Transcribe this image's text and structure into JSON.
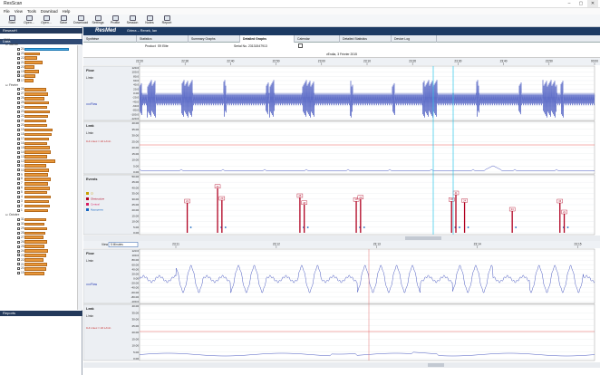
{
  "window": {
    "title": "ResScan",
    "min": "–",
    "max": "▢",
    "close": "✕"
  },
  "menu": [
    "File",
    "View",
    "Tools",
    "Download",
    "Help"
  ],
  "toolbar": [
    {
      "label": "Start",
      "icon": "start-icon"
    },
    {
      "label": "Open...",
      "icon": "folder-open-icon"
    },
    {
      "label": "Open...",
      "icon": "folder-open-icon"
    },
    {
      "label": "Save",
      "icon": "save-icon"
    },
    {
      "label": "Download",
      "icon": "download-icon"
    },
    {
      "label": "Settings",
      "icon": "gear-icon"
    },
    {
      "label": "Profile",
      "icon": "profile-icon"
    },
    {
      "label": "Session",
      "icon": "session-icon"
    },
    {
      "label": "Notes",
      "icon": "notes-icon"
    },
    {
      "label": "Report",
      "icon": "report-icon"
    }
  ],
  "left": {
    "header": "ResearH",
    "subheader": "Data",
    "reports_header": "Reports",
    "tree": [
      {
        "label": "2015",
        "level": 0
      },
      {
        "label": "Janvier",
        "level": 1
      },
      {
        "label": "24",
        "bar": 0.88,
        "selected": true
      },
      {
        "label": "23",
        "bar": 0.3
      },
      {
        "label": "22",
        "bar": 0.25
      },
      {
        "label": "21",
        "bar": 0.35
      },
      {
        "label": "20",
        "bar": 0.2
      },
      {
        "label": "19",
        "bar": 0.28
      },
      {
        "label": "18",
        "bar": 0.22
      },
      {
        "label": "17",
        "bar": 0.18
      },
      {
        "label": "Février",
        "level": 1
      },
      {
        "label": "28",
        "bar": 0.42
      },
      {
        "label": "27",
        "bar": 0.46
      },
      {
        "label": "26",
        "bar": 0.4
      },
      {
        "label": "25",
        "bar": 0.48
      },
      {
        "label": "24",
        "bar": 0.44
      },
      {
        "label": "23",
        "bar": 0.5
      },
      {
        "label": "22",
        "bar": 0.47
      },
      {
        "label": "21",
        "bar": 0.42
      },
      {
        "label": "20",
        "bar": 0.45
      },
      {
        "label": "19",
        "bar": 0.55
      },
      {
        "label": "18",
        "bar": 0.53
      },
      {
        "label": "17",
        "bar": 0.48
      },
      {
        "label": "16",
        "bar": 0.44
      },
      {
        "label": "15",
        "bar": 0.5
      },
      {
        "label": "14",
        "bar": 0.52
      },
      {
        "label": "13",
        "bar": 0.45
      },
      {
        "label": "12",
        "bar": 0.6
      },
      {
        "label": "11",
        "bar": 0.43
      },
      {
        "label": "10",
        "bar": 0.49
      },
      {
        "label": "9",
        "bar": 0.47
      },
      {
        "label": "8",
        "bar": 0.51
      },
      {
        "label": "7",
        "bar": 0.46
      },
      {
        "label": "6",
        "bar": 0.5
      },
      {
        "label": "5",
        "bar": 0.44
      },
      {
        "label": "4",
        "bar": 0.52
      },
      {
        "label": "3",
        "bar": 0.48
      },
      {
        "label": "2",
        "bar": 0.5
      },
      {
        "label": "1",
        "bar": 0.46
      },
      {
        "label": "Octobre",
        "level": 1
      },
      {
        "label": "31",
        "bar": 0.42
      },
      {
        "label": "30",
        "bar": 0.4
      },
      {
        "label": "29",
        "bar": 0.45
      },
      {
        "label": "28",
        "bar": 0.41
      },
      {
        "label": "27",
        "bar": 0.38
      },
      {
        "label": "26",
        "bar": 0.44
      },
      {
        "label": "25",
        "bar": 0.4
      },
      {
        "label": "24",
        "bar": 0.46
      },
      {
        "label": "23",
        "bar": 0.42
      },
      {
        "label": "22",
        "bar": 0.37
      },
      {
        "label": "21",
        "bar": 0.45
      },
      {
        "label": "20",
        "bar": 0.43
      },
      {
        "label": "19",
        "bar": 0.4
      }
    ]
  },
  "header": {
    "brand": "ResMed",
    "patient": "Griera – Renek, Ian"
  },
  "tabs": [
    "Synthèse",
    "Statistics",
    "Summary Graphs",
    "Detailed Graphs",
    "Calendar",
    "Detailed Statistics",
    "Device Log"
  ],
  "active_tab": "Detailed Graphs",
  "product": {
    "label": "Product",
    "value": "S9 Elite",
    "serial_label": "Serial No.",
    "serial_value": "23131547913"
  },
  "date": "vEndia, 3 Février 2015",
  "top": {
    "view_label": "View",
    "view_value": "2 Minutes",
    "times": [
      "22:20",
      "22:30",
      "22:40",
      "22:50",
      "23:00",
      "23:10",
      "23:20",
      "23:30",
      "23:40",
      "23:50",
      "00:00"
    ],
    "flow": {
      "title": "Flow",
      "unit": "L/min",
      "legend": "Flow",
      "yticks": [
        "120.0",
        "100.0",
        "80.0",
        "60.0",
        "40.0",
        "20.0",
        "0.00",
        "-20.0",
        "-40.0",
        "-60.0",
        "-80.0",
        "-100.0",
        "-120.0"
      ]
    },
    "leak": {
      "title": "Leak",
      "unit": "L/min",
      "threshold": "0-4 L/sec = 24 L/min",
      "yticks": [
        "40.00",
        "35.00",
        "30.00",
        "25.00",
        "20.00",
        "15.00",
        "10.00",
        "5.00",
        "0.00"
      ]
    },
    "events": {
      "title": "Events",
      "yticks": [
        "50.00",
        "45.00",
        "40.00",
        "35.00",
        "30.00",
        "25.00",
        "20.00",
        "15.00",
        "10.00",
        "5.00",
        "0.00"
      ],
      "legend": [
        {
          "label": "CI",
          "color": "#c8a000"
        },
        {
          "label": "Obstructive",
          "color": "#b00020"
        },
        {
          "label": "Central",
          "color": "#d81b60"
        },
        {
          "label": "Hypopnea",
          "color": "#1565c0"
        }
      ],
      "markers": [
        {
          "t": "22:26",
          "dur": "21",
          "h": 0.55
        },
        {
          "t": "22:33",
          "dur": "34",
          "h": 0.82
        },
        {
          "t": "22:34",
          "dur": "20",
          "h": 0.6
        },
        {
          "t": "22:52",
          "dur": "26",
          "h": 0.65
        },
        {
          "t": "22:53",
          "dur": "18",
          "h": 0.52
        },
        {
          "t": "23:05",
          "dur": "19",
          "h": 0.58
        },
        {
          "t": "23:06",
          "dur": "23",
          "h": 0.62
        },
        {
          "t": "23:27",
          "dur": "18",
          "h": 0.58
        },
        {
          "t": "23:28",
          "dur": "41",
          "h": 0.7
        },
        {
          "t": "23:30",
          "dur": "24",
          "h": 0.56
        },
        {
          "t": "23:41",
          "dur": "24",
          "h": 0.4
        },
        {
          "t": "23:52",
          "dur": "36",
          "h": 0.55
        },
        {
          "t": "23:53",
          "dur": "21",
          "h": 0.35
        }
      ]
    }
  },
  "bottom": {
    "view_label": "View",
    "view_value": "5 Minutes",
    "times": [
      "23:11",
      "23:12",
      "23:13",
      "23:14",
      "23:15"
    ],
    "flow": {
      "title": "Flow",
      "unit": "L/min",
      "legend": "Flow",
      "yticks": [
        "123.0",
        "100.0",
        "80.00",
        "60.00",
        "40.00",
        "20.00",
        "0.00",
        "-20.00",
        "-40.00",
        "-60.00",
        "-80.00",
        "-100.0"
      ]
    },
    "leak": {
      "title": "Leak",
      "unit": "L/min",
      "threshold": "0-4 L/sec = 24 L/min",
      "yticks": [
        "40.00",
        "35.00",
        "30.00",
        "25.00",
        "20.00",
        "15.00",
        "10.00",
        "5.00",
        "0.00"
      ]
    }
  }
}
